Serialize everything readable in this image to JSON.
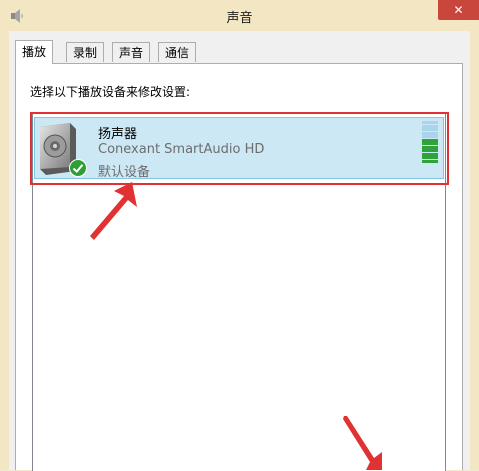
{
  "window": {
    "title": "声音",
    "close_label": "✕"
  },
  "tabs": [
    {
      "label": "播放",
      "active": true
    },
    {
      "label": "录制",
      "active": false
    },
    {
      "label": "声音",
      "active": false
    },
    {
      "label": "通信",
      "active": false
    }
  ],
  "playback": {
    "instruction": "选择以下播放设备来修改设置:",
    "devices": [
      {
        "name": "扬声器",
        "driver": "Conexant SmartAudio HD",
        "status": "默认设备",
        "selected": true,
        "default_icon": "green-check-icon",
        "level_meter": {
          "total_bars": 12,
          "lit_bars": 7
        }
      }
    ]
  },
  "colors": {
    "selection_fill": "#cce8f4",
    "selection_border": "#84c5e8",
    "annotation_red": "#e03232",
    "meter_green": "#2fa33b",
    "meter_idle": "#a9d4ea",
    "close_button": "#c9463d"
  },
  "icons": {
    "app": "speaker-app-icon",
    "device": "speaker-device-icon",
    "default_badge": "green-check-icon",
    "annotation_arrow": "red-arrow-icon"
  }
}
